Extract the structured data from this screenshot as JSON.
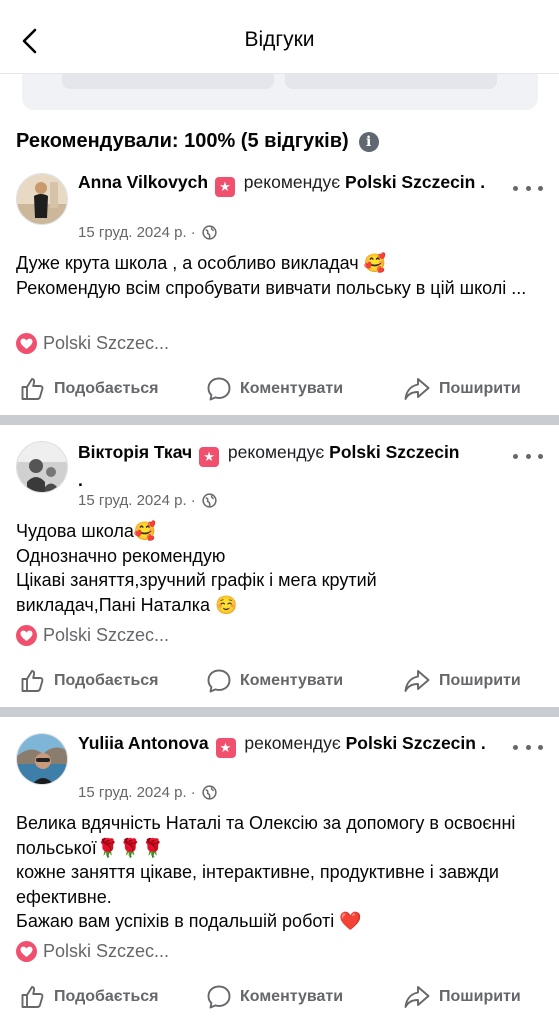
{
  "header": {
    "title": "Відгуки"
  },
  "summary": {
    "text": "Рекомендували: 100% (5 відгуків)"
  },
  "reviews": [
    {
      "name": "Anna Vilkovych",
      "recommends": "рекомендує",
      "page": "Polski Szczecin",
      "date": "15 груд. 2024 р. ·",
      "text": "Дуже крута школа , а особливо викладач 🥰\nРекомендую всім спробувати вивчати польську в цій школі ...",
      "tag": "Polski Szczec..."
    },
    {
      "name": "Вікторія Ткач",
      "recommends": "рекомендує",
      "page": "Polski Szczecin",
      "date": "15 груд. 2024 р. ·",
      "text": "Чудова школа🥰\nОднозначно рекомендую\nЦікаві заняття,зручний графік і мега крутий викладач,Пані Наталка ☺️",
      "tag": "Polski Szczec..."
    },
    {
      "name": "Yuliia Antonova",
      "recommends": "рекомендує",
      "page": "Polski Szczecin",
      "date": "15 груд. 2024 р. ·",
      "text": "Велика вдячність Наталі та Олексію за допомогу в освоєнні польської🌹🌹🌹\nкожне заняття цікаве, інтерактивне, продуктивне і завжди ефективне.\nБажаю вам успіхів в подальшій роботі ❤️",
      "tag": "Polski Szczec..."
    }
  ],
  "actions": {
    "like": "Подобається",
    "comment": "Коментувати",
    "share": "Поширити"
  },
  "icons": {
    "back": "chevron-left-icon",
    "info": "info-icon",
    "star": "recommend-star-icon",
    "globe": "globe-icon",
    "more": "more-icon",
    "heart": "heart-icon",
    "like": "thumbs-up-icon",
    "comment": "comment-icon",
    "share": "share-icon"
  },
  "colors": {
    "accent": "#f0506e",
    "secondary_text": "#65676b",
    "divider": "#c9ccd1"
  }
}
